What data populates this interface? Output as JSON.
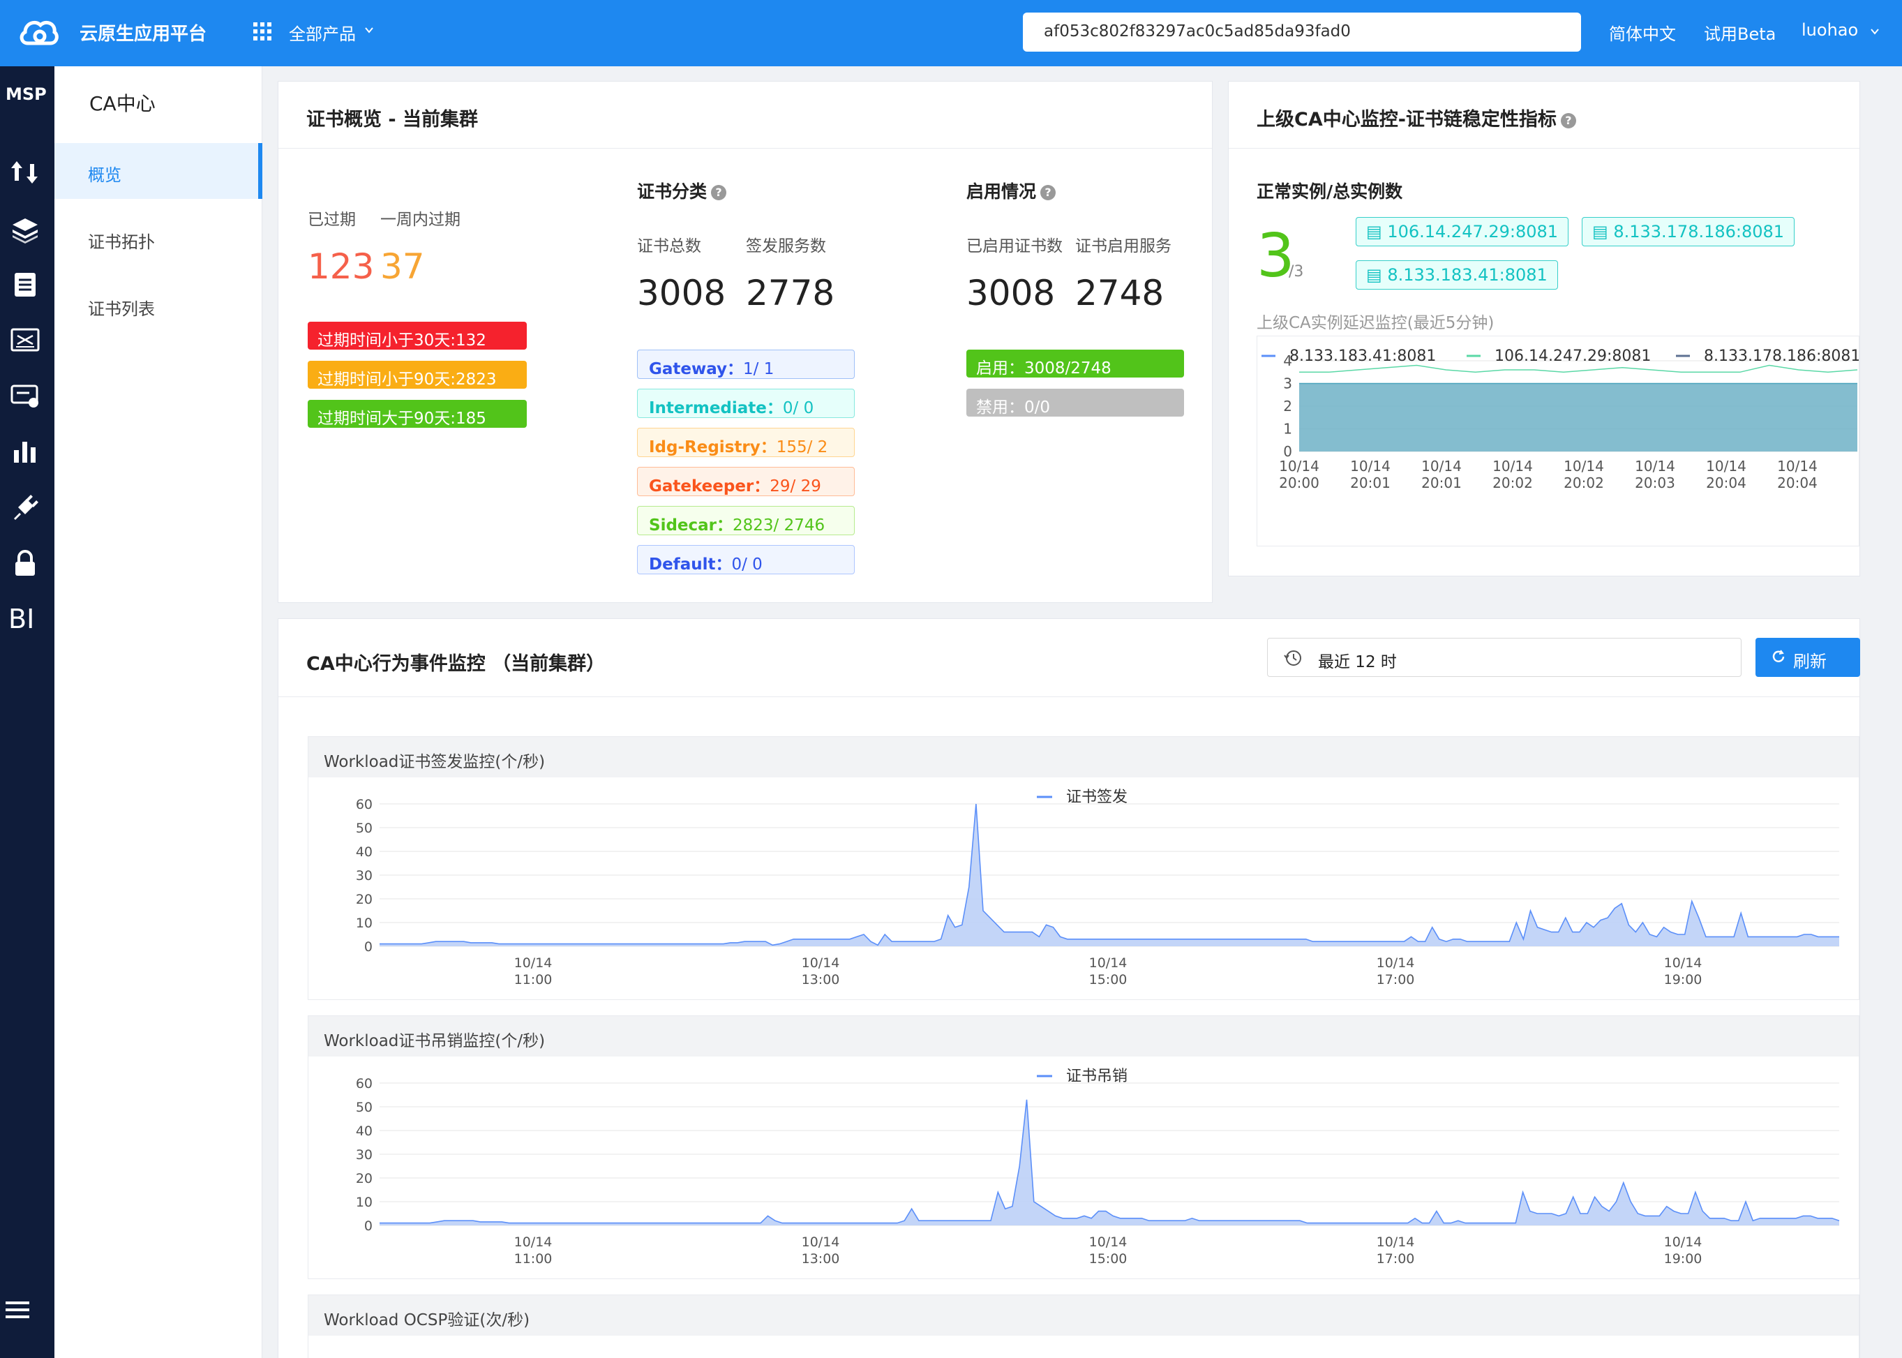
{
  "header": {
    "brand": "云原生应用平台",
    "products": "全部产品",
    "search_value": "af053c802f83297ac0c5ad85da93fad0",
    "lang": "简体中文",
    "beta": "试用Beta",
    "user": "luohao"
  },
  "rail": {
    "title": "MSP",
    "bi": "BI",
    "icons": [
      "transfer-icon",
      "layers-icon",
      "clipboard-icon",
      "certificate-icon",
      "server-monitor-icon",
      "bar-chart-icon",
      "plug-icon",
      "lock-icon",
      "menu-icon"
    ]
  },
  "sidebar": {
    "title": "CA中心",
    "items": [
      {
        "label": "概览"
      },
      {
        "label": "证书拓扑"
      },
      {
        "label": "证书列表"
      }
    ]
  },
  "overview": {
    "title": "证书概览 - 当前集群",
    "expired_label": "已过期",
    "week_label": "一周内过期",
    "expired": "123",
    "week": "37",
    "pills": [
      "过期时间小于30天:132",
      "过期时间小于90天:2823",
      "过期时间大于90天:185"
    ],
    "category_title": "证书分类",
    "total_label": "证书总数",
    "issue_label": "签发服务数",
    "total": "3008",
    "issue": "2778",
    "tags": [
      {
        "name": "Gateway：",
        "value": "1/ 1"
      },
      {
        "name": "Intermediate：",
        "value": "0/ 0"
      },
      {
        "name": "Idg-Registry：",
        "value": "155/ 2"
      },
      {
        "name": "Gatekeeper：",
        "value": "29/ 29"
      },
      {
        "name": "Sidecar：",
        "value": "2823/ 2746"
      },
      {
        "name": "Default：",
        "value": "0/ 0"
      }
    ],
    "enable_title": "启用情况",
    "enabled_label": "已启用证书数",
    "enabled_service_label": "证书启用服务",
    "enabled": "3008",
    "enabled_service": "2748",
    "on": "启用：3008/2748",
    "off": "禁用：0/0"
  },
  "upstream": {
    "title": "上级CA中心监控-证书链稳定性指标",
    "instances_label": "正常实例/总实例数",
    "normal": "3",
    "total": "/3",
    "ips": [
      "106.14.247.29:8081",
      "8.133.178.186:8081",
      "8.133.183.41:8081"
    ],
    "latency_label": "上级CA实例延迟监控(最近5分钟)"
  },
  "events": {
    "title": "CA中心行为事件监控 （当前集群）",
    "time_range": "最近 12 时",
    "refresh": "刷新",
    "panel3_title": "Workload OCSP验证(次/秒)"
  },
  "colors": {
    "primary": "#1e88f0",
    "red": "#f5222d",
    "orange": "#faad14",
    "green": "#52c41a",
    "teal": "#13c2c2"
  },
  "chart_data": [
    {
      "type": "area",
      "title": "上级CA实例延迟监控(最近5分钟)",
      "series": [
        {
          "name": "8.133.183.41:8081",
          "color": "#5b8ff9"
        },
        {
          "name": "106.14.247.29:8081",
          "color": "#5ad8a6"
        },
        {
          "name": "8.133.178.186:8081",
          "color": "#5d7092"
        }
      ],
      "x_ticks": [
        [
          "10/14",
          "20:00"
        ],
        [
          "10/14",
          "20:01"
        ],
        [
          "10/14",
          "20:01"
        ],
        [
          "10/14",
          "20:02"
        ],
        [
          "10/14",
          "20:02"
        ],
        [
          "10/14",
          "20:03"
        ],
        [
          "10/14",
          "20:04"
        ],
        [
          "10/14",
          "20:04"
        ]
      ],
      "ylim": [
        0,
        4
      ],
      "y_ticks": [
        0,
        1,
        2,
        3,
        4
      ],
      "values": [
        3.0,
        3.0,
        3.0,
        3.0,
        3.0,
        3.0,
        3.0,
        3.0,
        3.0,
        3.0,
        3.0,
        3.0,
        3.0,
        3.0,
        3.0,
        3.0,
        3.0,
        3.0,
        3.0,
        3.0
      ],
      "top_values": [
        3.5,
        3.5,
        3.6,
        3.7,
        3.8,
        3.6,
        3.5,
        3.6,
        3.6,
        3.5,
        3.6,
        3.7,
        3.6,
        3.5,
        3.5,
        3.5,
        3.8,
        3.6,
        3.5,
        3.6
      ]
    },
    {
      "type": "area",
      "title": "Workload证书签发监控(个/秒)",
      "series": [
        {
          "name": "证书签发",
          "color": "#5b8ff9"
        }
      ],
      "ylim": [
        0,
        60
      ],
      "y_ticks": [
        0,
        10,
        20,
        30,
        40,
        50,
        60
      ],
      "x_ticks": [
        [
          "10/14",
          "11:00"
        ],
        [
          "10/14",
          "13:00"
        ],
        [
          "10/14",
          "15:00"
        ],
        [
          "10/14",
          "17:00"
        ],
        [
          "10/14",
          "19:00"
        ]
      ],
      "values": [
        1,
        1,
        1,
        1,
        1,
        1,
        1,
        1.5,
        2,
        2,
        2,
        2,
        2,
        1.5,
        1.5,
        1.5,
        1.5,
        1,
        1,
        1,
        1,
        1,
        1,
        1,
        1,
        1,
        1,
        1,
        1,
        1,
        1,
        1,
        1,
        1,
        1,
        1,
        1,
        1,
        1,
        1,
        1,
        1,
        1,
        1,
        1,
        1,
        1,
        1,
        1,
        1,
        1.5,
        1.5,
        2,
        2,
        2,
        2,
        0.5,
        1,
        2,
        3,
        3,
        3,
        3,
        3,
        3,
        3,
        3,
        3,
        4,
        5,
        2,
        0.5,
        5,
        2,
        2,
        2,
        2,
        2,
        2,
        2,
        3,
        13,
        8,
        9,
        25,
        60,
        15,
        12,
        9,
        6,
        6,
        6,
        6,
        6,
        4,
        9,
        8,
        4,
        3,
        3,
        3,
        3,
        3,
        3,
        3,
        3,
        3,
        3,
        3,
        3,
        3,
        3,
        3,
        3,
        3,
        3,
        3,
        3,
        3,
        3,
        3,
        3,
        3,
        3,
        3,
        3,
        3,
        3,
        3,
        3,
        3,
        3,
        3,
        2,
        2,
        2,
        2,
        2,
        2,
        2,
        2,
        2,
        2,
        2,
        2,
        2,
        2,
        4,
        2,
        2,
        8,
        3,
        2,
        3,
        3,
        2,
        2,
        2,
        2,
        2,
        2,
        2,
        10,
        3,
        15,
        8,
        7,
        6,
        6,
        12,
        6,
        6,
        10,
        8,
        11,
        12,
        16,
        18,
        9,
        6,
        10,
        5,
        4,
        8,
        6,
        5,
        5,
        19,
        12,
        4,
        4,
        4,
        4,
        4,
        14,
        4,
        4,
        4,
        4,
        4,
        4,
        4,
        4,
        5,
        5,
        4,
        4,
        4,
        4
      ]
    },
    {
      "type": "area",
      "title": "Workload证书吊销监控(个/秒)",
      "series": [
        {
          "name": "证书吊销",
          "color": "#5b8ff9"
        }
      ],
      "ylim": [
        0,
        60
      ],
      "y_ticks": [
        0,
        10,
        20,
        30,
        40,
        50,
        60
      ],
      "x_ticks": [
        [
          "10/14",
          "11:00"
        ],
        [
          "10/14",
          "13:00"
        ],
        [
          "10/14",
          "15:00"
        ],
        [
          "10/14",
          "17:00"
        ],
        [
          "10/14",
          "19:00"
        ]
      ],
      "values": [
        1,
        1,
        1,
        1,
        1,
        1,
        1,
        1,
        1.5,
        2,
        2,
        2,
        2,
        2,
        1.5,
        1.5,
        1.5,
        1.5,
        1,
        1,
        1,
        1,
        1,
        1,
        1,
        1,
        1,
        1,
        1,
        1,
        1,
        1,
        1,
        1,
        1,
        1,
        1,
        1,
        1,
        1,
        1,
        1,
        1,
        1,
        1,
        1,
        1,
        1,
        1,
        1,
        1,
        1,
        1,
        1,
        4,
        2,
        1,
        1,
        1,
        1,
        1,
        1,
        1,
        1,
        1,
        1,
        1,
        1,
        1,
        1,
        1,
        1,
        1,
        2,
        7,
        2,
        2,
        2,
        2,
        2,
        2,
        2,
        2,
        2,
        2,
        2,
        14,
        7,
        8,
        25,
        53,
        10,
        8,
        6,
        4,
        3,
        3,
        3,
        4,
        3,
        6,
        6,
        4,
        3,
        3,
        3,
        3,
        2,
        2,
        2,
        2,
        2,
        2,
        3,
        2,
        2,
        2,
        2,
        2,
        2,
        2,
        2,
        2,
        2,
        2,
        2,
        2,
        2,
        2,
        1,
        1,
        1,
        1,
        1,
        1,
        1,
        1,
        1,
        1,
        1,
        1,
        1,
        1,
        1,
        3,
        1,
        1,
        6,
        1,
        1,
        2,
        1,
        1,
        1,
        1,
        1,
        1,
        1,
        1,
        14,
        6,
        5,
        5,
        5,
        4,
        5,
        12,
        5,
        5,
        12,
        8,
        6,
        10,
        18,
        10,
        5,
        4,
        4,
        4,
        8,
        6,
        5,
        5,
        14,
        6,
        3,
        3,
        3,
        2,
        2,
        10,
        2,
        3,
        3,
        3,
        3,
        3,
        3,
        4,
        4,
        3,
        3,
        3,
        2
      ]
    }
  ]
}
